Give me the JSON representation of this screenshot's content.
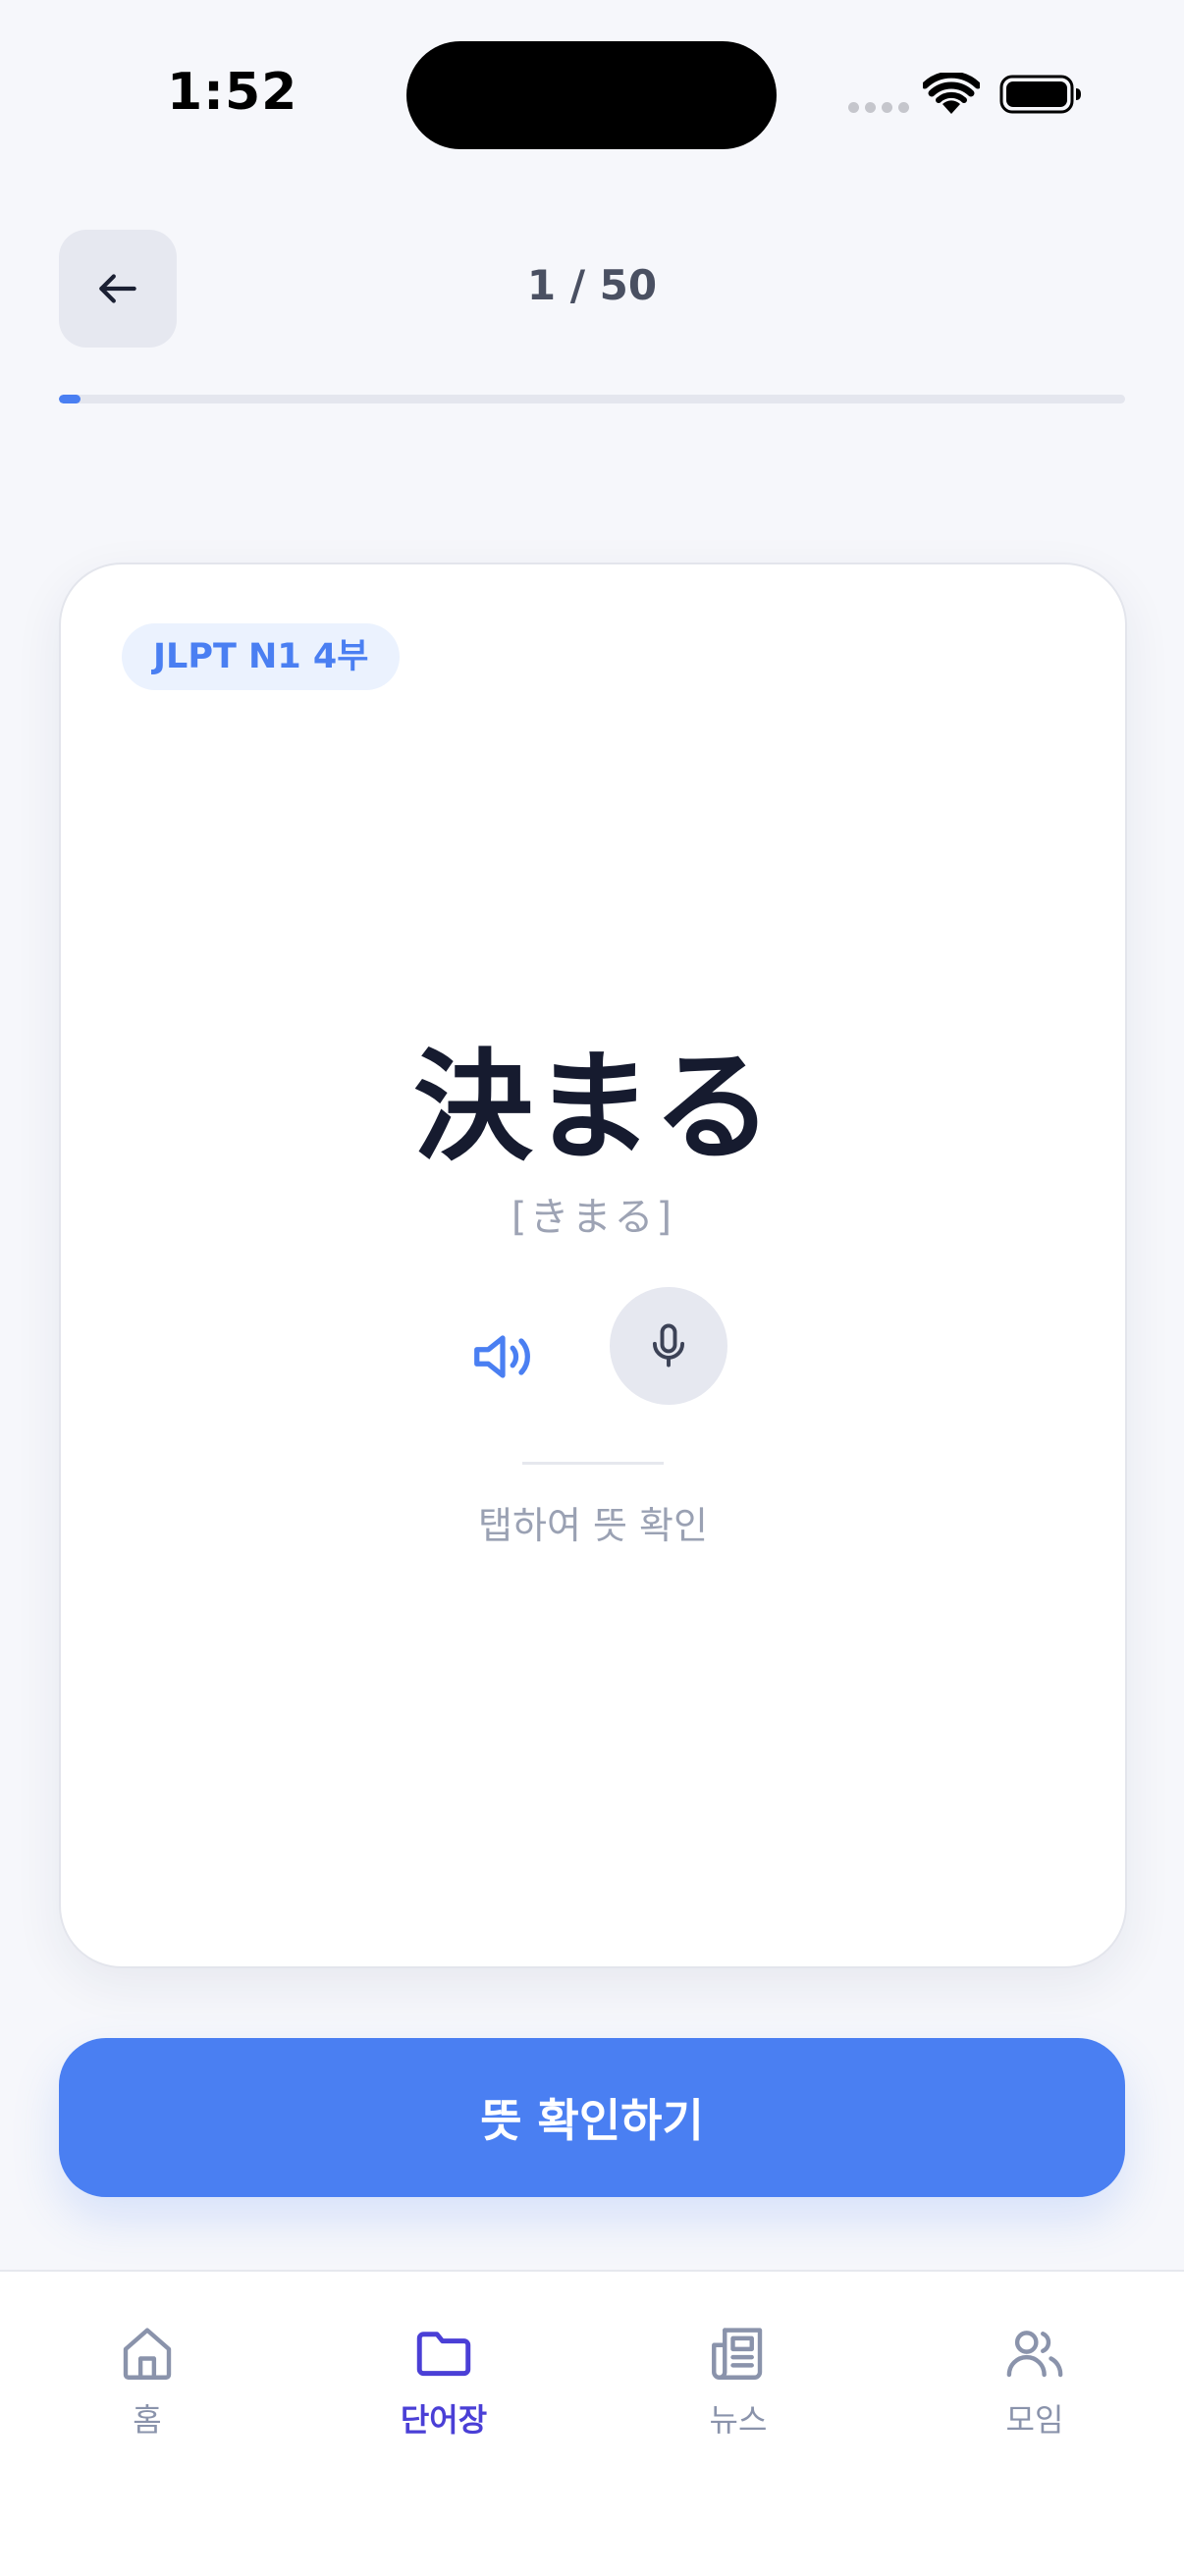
{
  "status_bar": {
    "time": "1:52"
  },
  "header": {
    "back_icon": "arrow-left-icon",
    "progress_text": "1 / 50",
    "progress_fraction": 0.02
  },
  "card": {
    "badge": "JLPT N1 4부",
    "word": "決まる",
    "reading": "[きまる]",
    "speaker_icon": "speaker-icon",
    "mic_icon": "microphone-icon",
    "hint": "탭하여 뜻 확인"
  },
  "cta": {
    "label": "뜻 확인하기"
  },
  "nav": {
    "items": [
      {
        "label": "홈",
        "icon": "home-icon",
        "active": false
      },
      {
        "label": "단어장",
        "icon": "folder-icon",
        "active": true
      },
      {
        "label": "뉴스",
        "icon": "newspaper-icon",
        "active": false
      },
      {
        "label": "모임",
        "icon": "users-icon",
        "active": false
      }
    ]
  },
  "colors": {
    "accent": "#4a7ff2",
    "nav_active": "#4a3fd6",
    "nav_inactive": "#8a93ab",
    "background": "#f6f7fb"
  }
}
